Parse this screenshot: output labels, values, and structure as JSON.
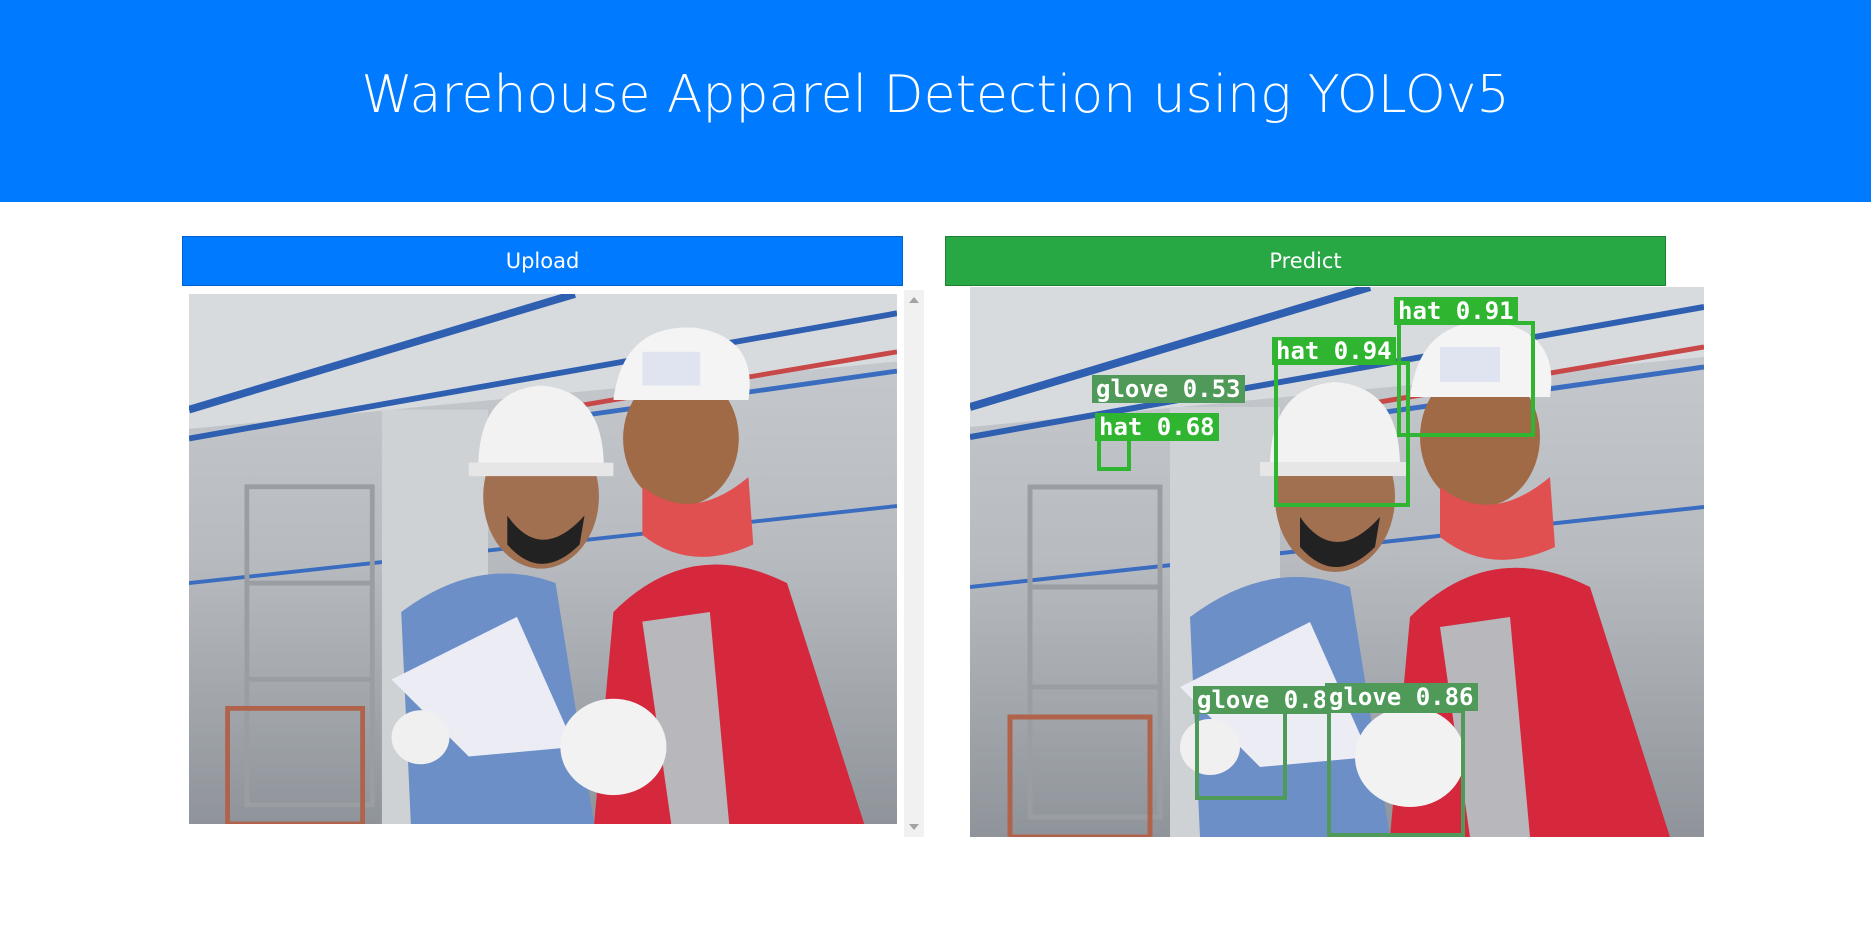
{
  "header": {
    "title": "Warehouse Apparel Detection using YOLOv5"
  },
  "actions": {
    "upload_label": "Upload",
    "predict_label": "Predict"
  },
  "colors": {
    "header_bg": "#007bff",
    "upload_bg": "#007bff",
    "predict_bg": "#28a745",
    "detection_hat": "#2fb52f",
    "detection_glove": "#4f9a58"
  },
  "input_image": {
    "description_icon": "uploaded-photo"
  },
  "detections": [
    {
      "label": "hat 0.91"
    },
    {
      "label": "hat 0.94"
    },
    {
      "label": "glove 0.53"
    },
    {
      "label": "hat 0.68"
    },
    {
      "label": "glove 0.8"
    },
    {
      "label": "glove 0.86"
    }
  ]
}
